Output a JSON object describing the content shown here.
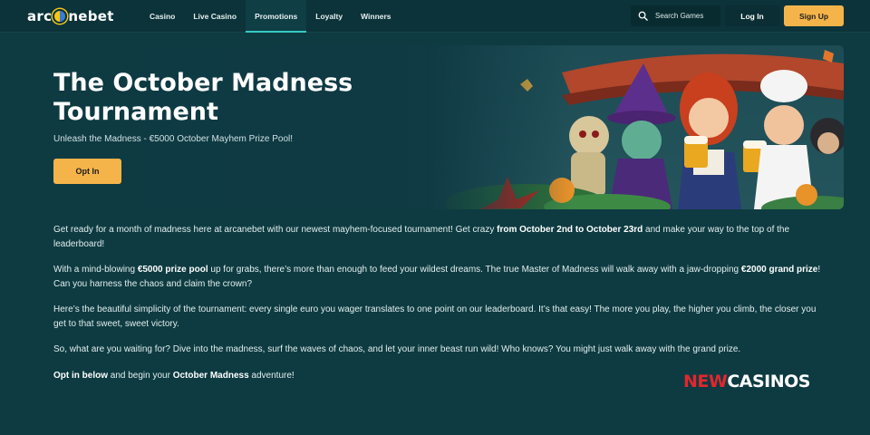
{
  "header": {
    "logo_left": "arc",
    "logo_right": "nebet",
    "nav": [
      {
        "label": "Casino",
        "active": false
      },
      {
        "label": "Live Casino",
        "active": false
      },
      {
        "label": "Promotions",
        "active": true
      },
      {
        "label": "Loyalty",
        "active": false
      },
      {
        "label": "Winners",
        "active": false
      }
    ],
    "search_label": "Search Games",
    "login_label": "Log In",
    "signup_label": "Sign Up"
  },
  "banner": {
    "title": "The October Madness Tournament",
    "subtitle": "Unleash the Madness - €5000 October Mayhem Prize Pool!",
    "optin_label": "Opt In"
  },
  "content": {
    "p1": {
      "a": "Get ready for a month of madness here at arcanebet with our newest mayhem-focused tournament! Get crazy ",
      "b": "from October 2nd to October 23rd",
      "c": " and make your way to the top of the leaderboard!"
    },
    "p2": {
      "a": "With a mind-blowing ",
      "b": "€5000 prize pool",
      "c": " up for grabs, there’s more than enough to feed your wildest dreams. The true Master of Madness will walk away with a jaw-dropping ",
      "d": "€2000 grand prize",
      "e": "! Can you harness the chaos and claim the crown?"
    },
    "p3": "Here’s the beautiful simplicity of the tournament: every single euro you wager translates to one point on our leaderboard. It’s that easy! The more you play, the higher you climb, the closer you get to that sweet, sweet victory.",
    "p4": "So, what are you waiting for? Dive into the madness, surf the waves of chaos, and let your inner beast run wild! Who knows? You might just walk away with the grand prize.",
    "p5": {
      "a": "Opt in below",
      "b": " and begin your ",
      "c": "October Madness",
      "d": " adventure!"
    }
  },
  "watermark": {
    "red": "NEW",
    "white": "CASINOS"
  },
  "colors": {
    "background": "#0d3b41",
    "header": "#0b3339",
    "accent_button": "#f5b44a",
    "active_tab_underline": "#38c9c4",
    "watermark_red": "#e3262e"
  },
  "icons": {
    "search": "search-icon",
    "logo": "logo-o-icon"
  }
}
